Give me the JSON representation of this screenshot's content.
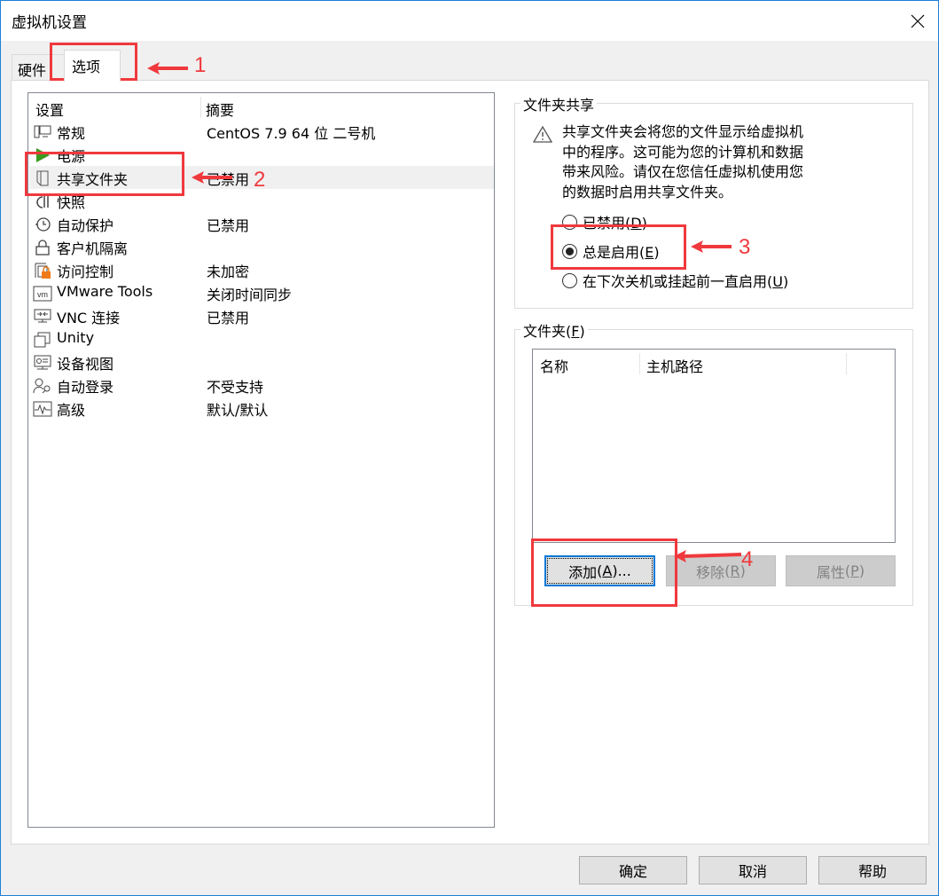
{
  "window": {
    "title": "虚拟机设置",
    "close_icon": "close-icon"
  },
  "tabs": [
    {
      "label": "硬件",
      "active": false
    },
    {
      "label": "选项",
      "active": true
    }
  ],
  "settings_list": {
    "headers": {
      "setting": "设置",
      "summary": "摘要"
    },
    "rows": [
      {
        "icon": "monitor-icon",
        "name": "常规",
        "summary": "CentOS 7.9 64 位 二号机",
        "selected": false
      },
      {
        "icon": "power-play-icon",
        "name": "电源",
        "summary": "",
        "selected": false
      },
      {
        "icon": "shared-folder-icon",
        "name": "共享文件夹",
        "summary": "已禁用",
        "selected": true
      },
      {
        "icon": "snapshot-icon",
        "name": "快照",
        "summary": "",
        "selected": false
      },
      {
        "icon": "autoprotect-clock-icon",
        "name": "自动保护",
        "summary": "已禁用",
        "selected": false
      },
      {
        "icon": "lock-icon",
        "name": "客户机隔离",
        "summary": "",
        "selected": false
      },
      {
        "icon": "access-control-lock-icon",
        "name": "访问控制",
        "summary": "未加密",
        "selected": false
      },
      {
        "icon": "vmware-tools-icon",
        "name": "VMware Tools",
        "summary": "关闭时间同步",
        "selected": false
      },
      {
        "icon": "vnc-icon",
        "name": "VNC 连接",
        "summary": "已禁用",
        "selected": false
      },
      {
        "icon": "unity-icon",
        "name": "Unity",
        "summary": "",
        "selected": false
      },
      {
        "icon": "device-view-icon",
        "name": "设备视图",
        "summary": "",
        "selected": false
      },
      {
        "icon": "autologin-user-icon",
        "name": "自动登录",
        "summary": "不受支持",
        "selected": false
      },
      {
        "icon": "advanced-pulse-icon",
        "name": "高级",
        "summary": "默认/默认",
        "selected": false
      }
    ]
  },
  "folder_sharing": {
    "title": "文件夹共享",
    "warning": "共享文件夹会将您的文件显示给虚拟机中的程序。这可能为您的计算机和数据带来风险。请仅在您信任虚拟机使用您的数据时启用共享文件夹。",
    "warning_lines": [
      "共享文件夹会将您的文件显示给虚拟机",
      "中的程序。这可能为您的计算机和数据",
      "带来风险。请仅在您信任虚拟机使用您",
      "的数据时启用共享文件夹。"
    ],
    "options": [
      {
        "label": "已禁用",
        "mnemonic": "D",
        "checked": false
      },
      {
        "label": "总是启用",
        "mnemonic": "E",
        "checked": true
      },
      {
        "label": "在下次关机或挂起前一直启用",
        "mnemonic": "U",
        "checked": false
      }
    ]
  },
  "folders": {
    "title": "文件夹",
    "mnemonic": "F",
    "columns": [
      "名称",
      "主机路径"
    ],
    "rows": [],
    "buttons": [
      {
        "label": "添加",
        "mnemonic": "A",
        "suffix": "...",
        "enabled": true
      },
      {
        "label": "移除",
        "mnemonic": "R",
        "suffix": "",
        "enabled": false
      },
      {
        "label": "属性",
        "mnemonic": "P",
        "suffix": "",
        "enabled": false
      }
    ]
  },
  "footer": {
    "ok": "确定",
    "cancel": "取消",
    "help": "帮助"
  },
  "annotations": [
    "1",
    "2",
    "3",
    "4"
  ],
  "colors": {
    "annotation": "#f0393d",
    "accent": "#0078d7",
    "selected_row": "#f0f0f0"
  }
}
